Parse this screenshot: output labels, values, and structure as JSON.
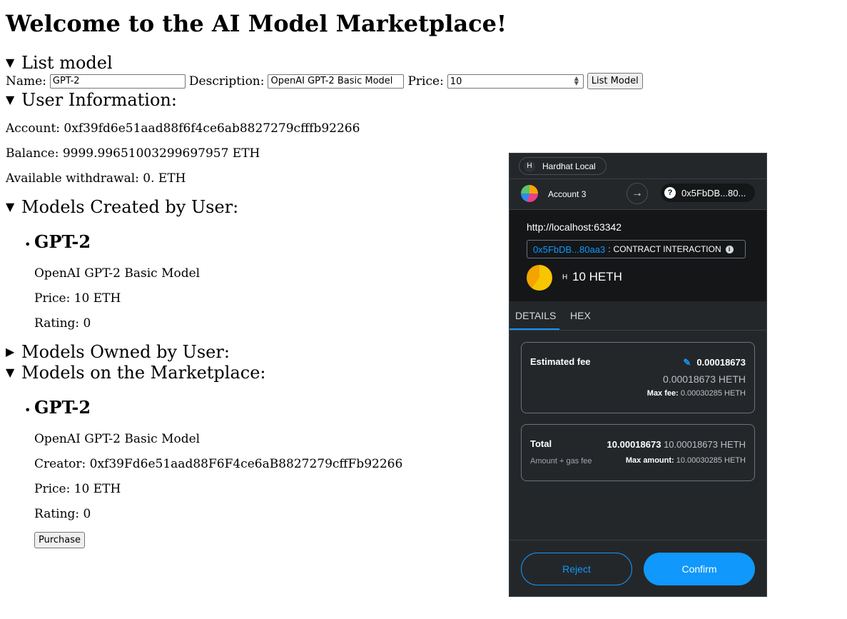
{
  "page": {
    "title": "Welcome to the AI Model Marketplace!",
    "list_model": {
      "summary": "List model",
      "name_label": "Name:",
      "name_value": "GPT-2",
      "description_label": "Description:",
      "description_value": "OpenAI GPT-2 Basic Model",
      "price_label": "Price:",
      "price_value": "10",
      "submit_label": "List Model"
    },
    "user_info": {
      "summary": "User Information:",
      "account": "Account: 0xf39fd6e51aad88f6f4ce6ab8827279cfffb92266",
      "balance": "Balance: 9999.99651003299697957 ETH",
      "withdrawal": "Available withdrawal: 0. ETH"
    },
    "models_created": {
      "summary": "Models Created by User:",
      "items": [
        {
          "name": "GPT-2",
          "description": "OpenAI GPT-2 Basic Model",
          "price": "Price: 10 ETH",
          "rating": "Rating: 0"
        }
      ]
    },
    "models_owned": {
      "summary": "Models Owned by User:"
    },
    "marketplace": {
      "summary": "Models on the Marketplace:",
      "items": [
        {
          "name": "GPT-2",
          "description": "OpenAI GPT-2 Basic Model",
          "creator": "Creator: 0xf39Fd6e51aad88F6F4ce6aB8827279cffFb92266",
          "price": "Price: 10 ETH",
          "rating": "Rating: 0",
          "purchase_label": "Purchase"
        }
      ]
    },
    "triangles": {
      "open": "▼",
      "closed": "▶"
    }
  },
  "wallet": {
    "network": "Hardhat Local",
    "network_initial": "H",
    "account_name": "Account 3",
    "to_address": "0x5FbDB...80...",
    "origin": "http://localhost:63342",
    "contract_address": "0x5FbDB...80aa3",
    "contract_sep": ":",
    "contract_label": "CONTRACT INTERACTION",
    "token_symbol_initial": "H",
    "amount": "10 HETH",
    "tabs": [
      "DETAILS",
      "HEX"
    ],
    "fee": {
      "label": "Estimated fee",
      "value": "0.00018673",
      "secondary": "0.00018673 HETH",
      "max_label": "Max fee:",
      "max_value": "0.00030285 HETH"
    },
    "total": {
      "label": "Total",
      "value": "10.00018673",
      "value_secondary": "10.00018673 HETH",
      "sub_label": "Amount + gas fee",
      "max_label": "Max amount:",
      "max_value": "10.00030285 HETH"
    },
    "reject_label": "Reject",
    "confirm_label": "Confirm",
    "colors": {
      "accent": "#1098fc",
      "background": "#24272a"
    }
  }
}
